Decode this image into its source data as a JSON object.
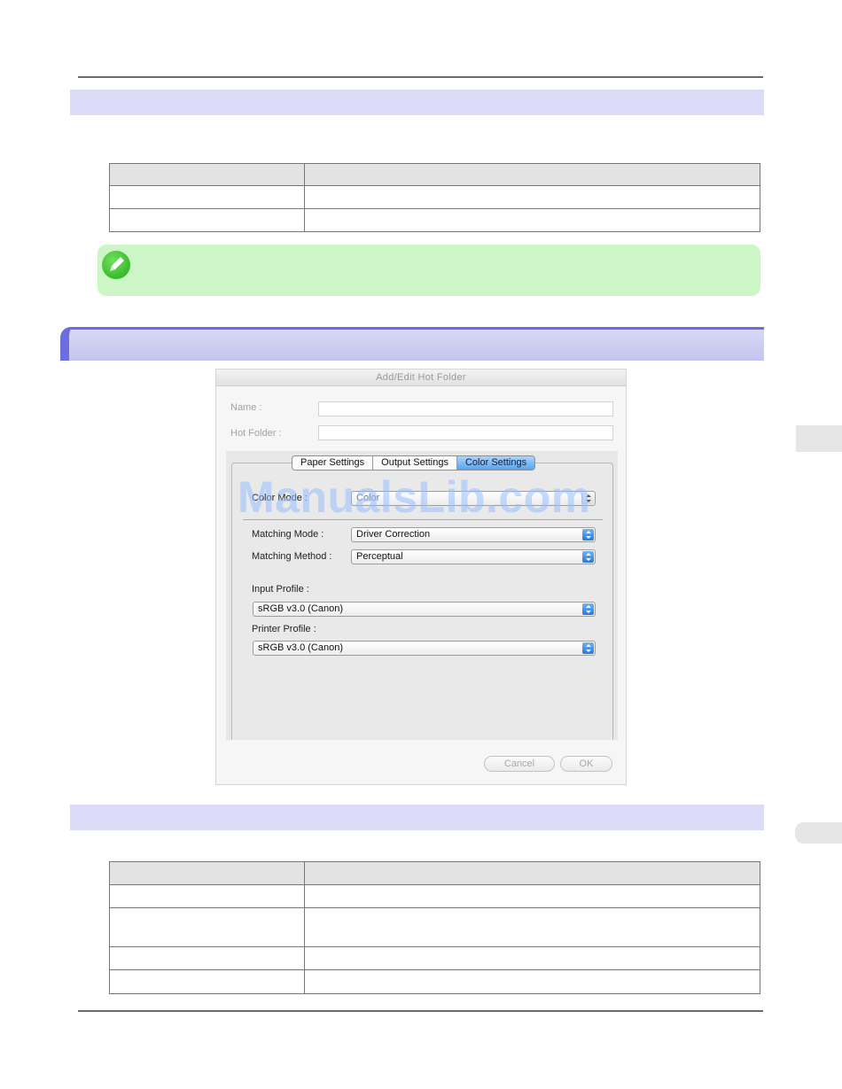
{
  "dialog": {
    "title": "Add/Edit Hot Folder",
    "name_label": "Name :",
    "name_value": "",
    "hot_folder_label": "Hot Folder :",
    "hot_folder_value": "",
    "tabs": [
      {
        "label": "Paper Settings",
        "active": false
      },
      {
        "label": "Output Settings",
        "active": false
      },
      {
        "label": "Color Settings",
        "active": true
      }
    ],
    "color_mode": {
      "label": "Color Mode :",
      "value": "Color"
    },
    "matching_mode": {
      "label": "Matching Mode :",
      "value": "Driver Correction"
    },
    "matching_method": {
      "label": "Matching Method :",
      "value": "Perceptual"
    },
    "input_profile": {
      "label": "Input Profile :",
      "value": "sRGB v3.0 (Canon)"
    },
    "printer_profile": {
      "label": "Printer Profile :",
      "value": "sRGB v3.0 (Canon)"
    },
    "cancel_label": "Cancel",
    "ok_label": "OK"
  },
  "watermark": "ManualsLib.com",
  "colors": {
    "header_bar": "#dcdcf8",
    "section_accent": "#6d6de0",
    "note_green": "#ccf6c6",
    "tab_active": "#5aa3ef"
  }
}
